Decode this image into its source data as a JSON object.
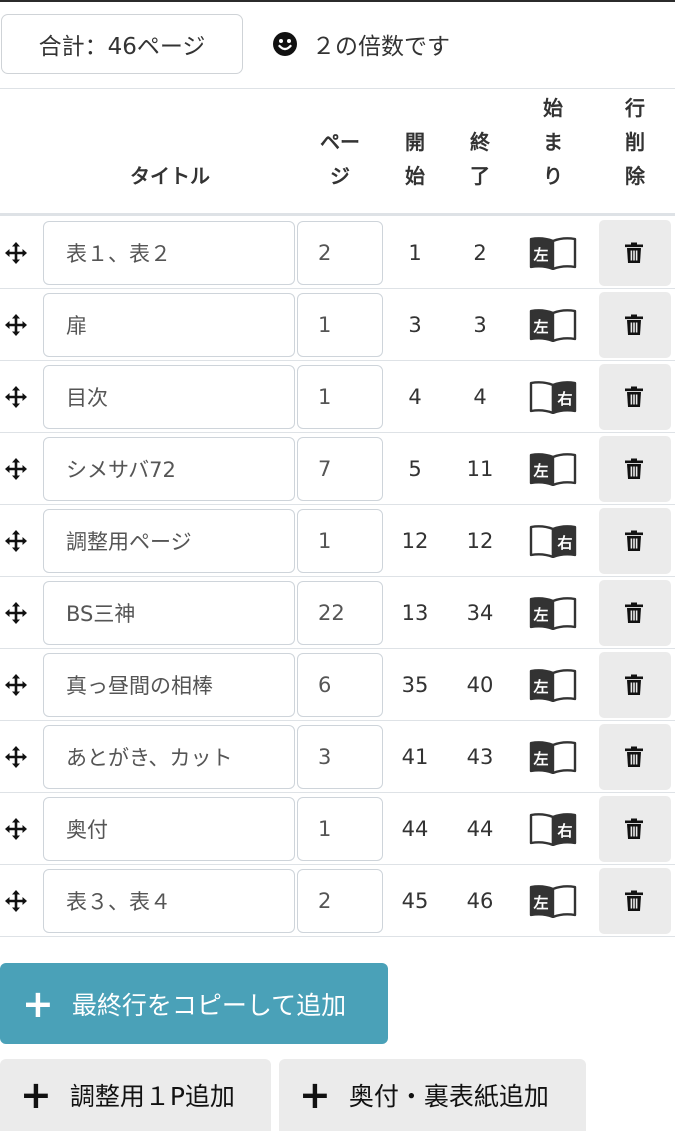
{
  "summary": {
    "total": "合計：46ページ",
    "status": "２の倍数です",
    "status_icon": "smile-icon"
  },
  "table": {
    "headers": {
      "title": "タイトル",
      "pages": [
        "ペー",
        "ジ"
      ],
      "start": [
        "開",
        "始"
      ],
      "end": [
        "終",
        "了"
      ],
      "begin": [
        "始",
        "ま",
        "り"
      ],
      "delete": [
        "行",
        "削",
        "除"
      ]
    },
    "rows": [
      {
        "title": "表１、表２",
        "pages": "2",
        "start": "1",
        "end": "2",
        "side": "左"
      },
      {
        "title": "扉",
        "pages": "1",
        "start": "3",
        "end": "3",
        "side": "左"
      },
      {
        "title": "目次",
        "pages": "1",
        "start": "4",
        "end": "4",
        "side": "右"
      },
      {
        "title": "シメサバ72",
        "pages": "7",
        "start": "5",
        "end": "11",
        "side": "左"
      },
      {
        "title": "調整用ページ",
        "pages": "1",
        "start": "12",
        "end": "12",
        "side": "右"
      },
      {
        "title": "BS三神",
        "pages": "22",
        "start": "13",
        "end": "34",
        "side": "左"
      },
      {
        "title": "真っ昼間の相棒",
        "pages": "6",
        "start": "35",
        "end": "40",
        "side": "左"
      },
      {
        "title": "あとがき、カット",
        "pages": "3",
        "start": "41",
        "end": "43",
        "side": "左"
      },
      {
        "title": "奥付",
        "pages": "1",
        "start": "44",
        "end": "44",
        "side": "右"
      },
      {
        "title": "表３、表４",
        "pages": "2",
        "start": "45",
        "end": "46",
        "side": "左"
      }
    ]
  },
  "buttons": {
    "copy_last": "最終行をコピーして追加",
    "add_adjust": "調整用１P追加",
    "add_colophon": "奥付・裏表紙追加",
    "plus": "+"
  },
  "colors": {
    "accent": "#4aa1b8",
    "gray_button": "#ebebeb",
    "border": "#dee2e6"
  }
}
